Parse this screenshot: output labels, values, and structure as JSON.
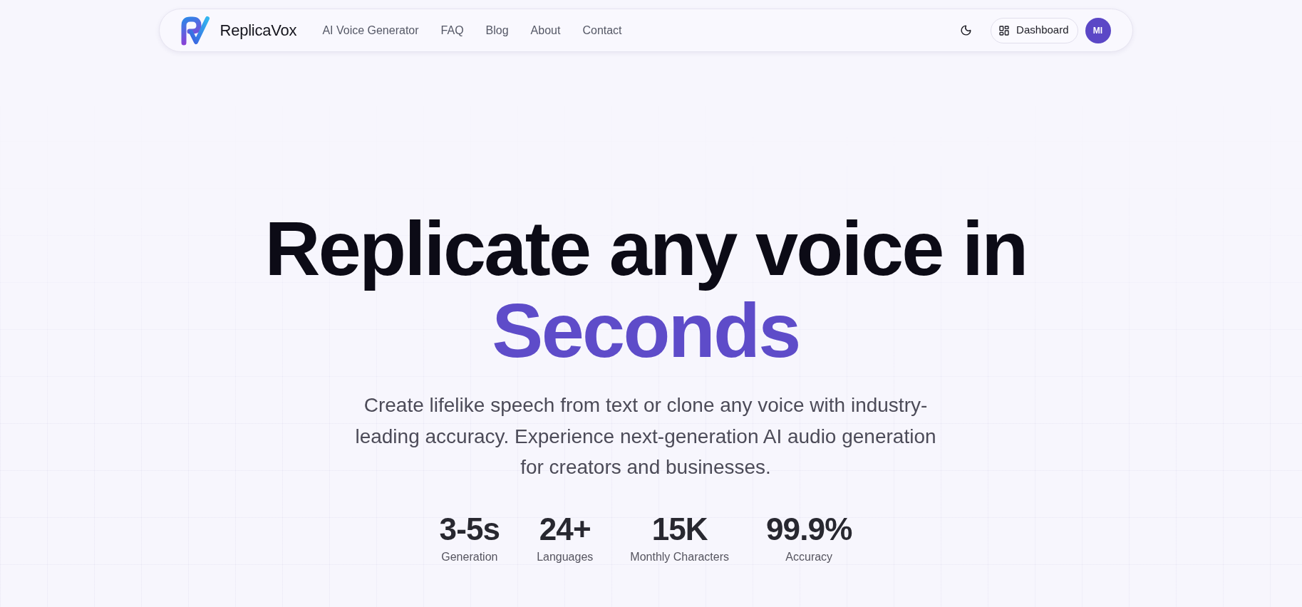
{
  "navbar": {
    "brand": "ReplicaVox",
    "links": [
      {
        "label": "AI Voice Generator"
      },
      {
        "label": "FAQ"
      },
      {
        "label": "Blog"
      },
      {
        "label": "About"
      },
      {
        "label": "Contact"
      }
    ],
    "dashboard_button": "Dashboard",
    "avatar_initials": "MI"
  },
  "hero": {
    "headline": "Replicate any voice in",
    "headline_highlight": "Seconds",
    "description": "Create lifelike speech from text or clone any voice with industry-leading accuracy. Experience next-generation AI audio generation for creators and businesses.",
    "stats": [
      {
        "value": "3-5s",
        "label": "Generation"
      },
      {
        "value": "24+",
        "label": "Languages"
      },
      {
        "value": "15K",
        "label": "Monthly Characters"
      },
      {
        "value": "99.9%",
        "label": "Accuracy"
      }
    ]
  }
}
